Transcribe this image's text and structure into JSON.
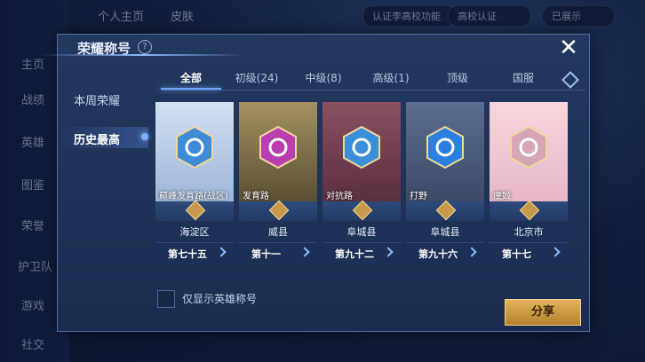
{
  "background": {
    "nav": [
      "主页",
      "战绩",
      "英雄",
      "图鉴",
      "荣誉",
      "护卫队",
      "游戏",
      "社交"
    ],
    "top_tabs": [
      "个人主页",
      "皮肤"
    ],
    "pill_left": "认证李高校功能",
    "pill_mid": "高校认证",
    "pill_right": "已展示"
  },
  "modal": {
    "title": "荣耀称号",
    "help": "?",
    "close": "✕",
    "left_tabs": [
      "本周荣耀",
      "历史最高"
    ],
    "active_left_tab": 1,
    "tabs": [
      "全部",
      "初级(24)",
      "中级(8)",
      "高级(1)",
      "顶级",
      "国服"
    ],
    "active_tab": 0,
    "cards": [
      {
        "name": "巅峰发育路(战区)",
        "region": "海淀区",
        "rank": "第七十五",
        "color1": "#9fb6d8",
        "color2": "#d2dff1",
        "emblem": "#3e8cd8",
        "icon": "s-emblem-icon"
      },
      {
        "name": "发育路",
        "region": "威县",
        "rank": "第十一",
        "color1": "#5a4f34",
        "color2": "#a49160",
        "emblem": "#b93fb0",
        "icon": "s-emblem-icon"
      },
      {
        "name": "对抗路",
        "region": "阜城县",
        "rank": "第九十二",
        "color1": "#5a3040",
        "color2": "#8a5060",
        "emblem": "#3a8fd8",
        "icon": "sword-emblem-icon"
      },
      {
        "name": "打野",
        "region": "阜城县",
        "rank": "第九十六",
        "color1": "#3c4a66",
        "color2": "#5b6d90",
        "emblem": "#2a7fe0",
        "icon": "dragon-emblem-icon"
      },
      {
        "name": "虞姬",
        "region": "北京市",
        "rank": "第十七",
        "color1": "#e8b7c8",
        "color2": "#f6d6dc",
        "emblem": "#d6a6b8",
        "icon": "hero-portrait"
      }
    ],
    "checkbox_label": "仅显示英雄称号",
    "share": "分享"
  }
}
